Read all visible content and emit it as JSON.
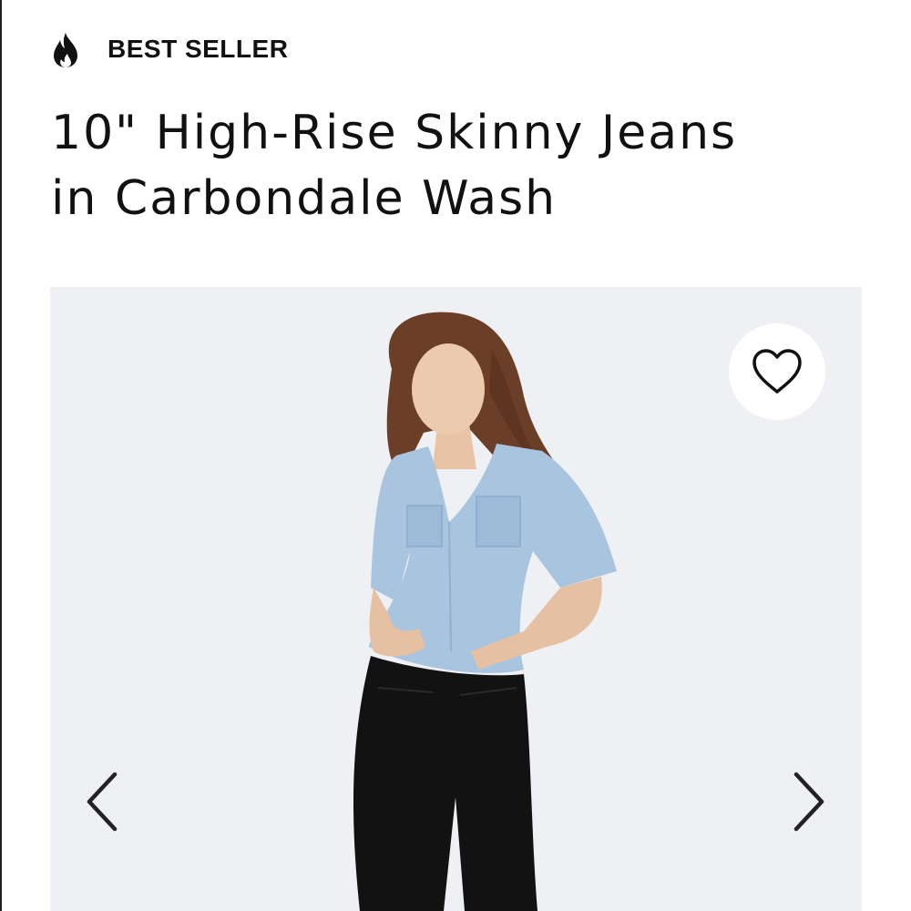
{
  "badge": {
    "label": "BEST SELLER",
    "icon": "flame-icon"
  },
  "product": {
    "title_line1": "10\" High-Rise Skinny Jeans",
    "title_line2": "in Carbondale Wash"
  },
  "gallery": {
    "favorite_icon": "heart-icon",
    "prev_icon": "chevron-left-icon",
    "next_icon": "chevron-right-icon"
  },
  "colors": {
    "text": "#111111",
    "gallery_background": "#eef0f4",
    "shirt": "#a9c4df",
    "jeans": "#121212"
  }
}
